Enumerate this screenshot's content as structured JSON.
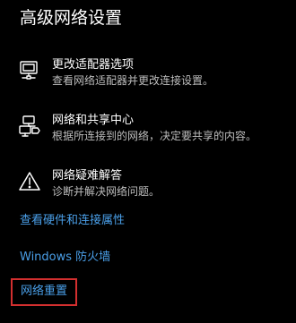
{
  "page": {
    "title": "高级网络设置"
  },
  "settings": [
    {
      "name": "更改适配器选项",
      "desc": "查看网络适配器并更改连接设置。",
      "icon": "network-adapter-icon"
    },
    {
      "name": "网络和共享中心",
      "desc": "根据所连接到的网络，决定要共享的内容。",
      "icon": "sharing-center-icon"
    },
    {
      "name": "网络疑难解答",
      "desc": "诊断并解决网络问题。",
      "icon": "warning-triangle-icon"
    }
  ],
  "links": {
    "hardware": "查看硬件和连接属性",
    "firewall": "Windows 防火墙",
    "reset": "网络重置"
  },
  "colors": {
    "background": "#000000",
    "text": "#ffffff",
    "secondary_text": "#bdbdbd",
    "link": "#4a9fe8",
    "highlight_border": "#d32f2f"
  }
}
